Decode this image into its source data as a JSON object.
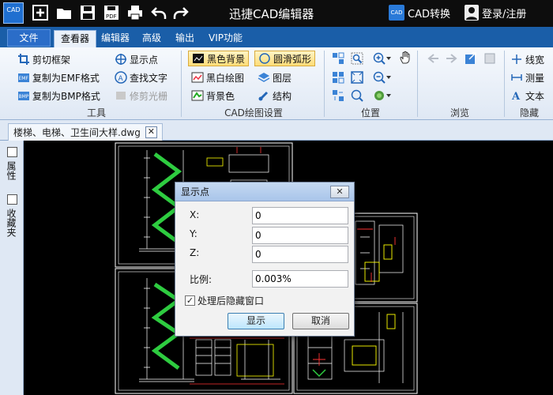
{
  "titlebar": {
    "app_title": "迅捷CAD编辑器",
    "logo_text": "CAD",
    "cad_convert_label": "CAD转换",
    "login_label": "登录/注册"
  },
  "tabs": {
    "file": "文件",
    "viewer": "查看器",
    "editor": "编辑器",
    "advanced": "高级",
    "output": "输出",
    "vip": "VIP功能"
  },
  "ribbon": {
    "tools": {
      "crop_frame": "剪切框架",
      "copy_emf": "复制为EMF格式",
      "copy_bmp": "复制为BMP格式",
      "show_point": "显示点",
      "find_text": "查找文字",
      "trim_raster": "修剪光栅",
      "label": "工具"
    },
    "cad_settings": {
      "black_bg": "黑色背景",
      "bw_drawing": "黑白绘图",
      "bg_color": "背景色",
      "smooth_arc": "圆滑弧形",
      "layers": "图层",
      "structure": "结构",
      "label": "CAD绘图设置"
    },
    "position": {
      "label": "位置"
    },
    "browse": {
      "label": "浏览"
    },
    "hide": {
      "linewidth": "线宽",
      "measure": "测量",
      "text": "文本",
      "label": "隐藏"
    }
  },
  "document": {
    "tab_name": "楼梯、电梯、卫生间大样.dwg"
  },
  "side_panel": {
    "properties": "属性",
    "favorites": "收藏夹"
  },
  "dialog": {
    "title": "显示点",
    "x_label": "X:",
    "y_label": "Y:",
    "z_label": "Z:",
    "x_value": "0",
    "y_value": "0",
    "z_value": "0",
    "scale_label": "比例:",
    "scale_value": "0.003%",
    "hide_after_label": "处理后隐藏窗口",
    "hide_after_checked": true,
    "ok_label": "显示",
    "cancel_label": "取消"
  },
  "colors": {
    "ribbon_tab_bar": "#1a5ea8",
    "canvas_bg": "#000000",
    "cad_lines": "#ffffff",
    "cad_stair": "#2ecc40",
    "cad_accent_red": "#ff3333",
    "cad_accent_yellow": "#ffff00"
  }
}
